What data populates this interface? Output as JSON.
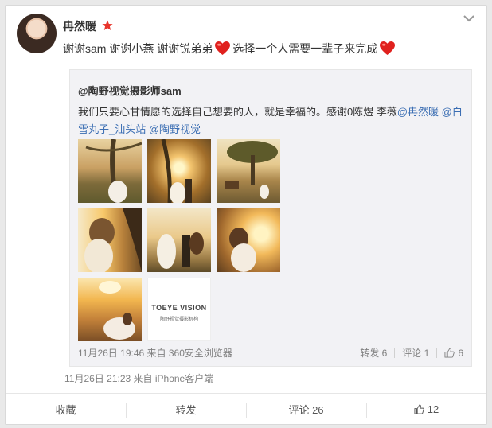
{
  "post": {
    "author": "冉然暖",
    "text_parts": [
      "谢谢sam 谢谢小燕 谢谢锐弟弟",
      "选择一个人需要一辈子来完成"
    ],
    "time": "11月26日 21:23",
    "source": "来自 iPhone客户端"
  },
  "repost": {
    "author": "@陶野视觉摄影师sam",
    "text": "我们只要心甘情愿的选择自己想要的人，就是幸福的。感谢0陈煜 李薇",
    "mentions": [
      "@冉然暖",
      "@白雪丸子_汕头站",
      "@陶野视觉"
    ],
    "time": "11月26日 19:46",
    "source": "来自 360安全浏览器",
    "repost_label": "转发 6",
    "comment_label": "评论 1",
    "like_count": "6",
    "logo_main": "TOEYE VISION",
    "logo_sub": "陶野视觉摄影机构"
  },
  "actions": {
    "favorite": "收藏",
    "repost": "转发",
    "comment": "评论 26",
    "like_count": "12"
  },
  "colors": {
    "link": "#3b6eb3",
    "vip_star": "#e8352b",
    "heart": "#e0211e",
    "meta_text": "#808080"
  },
  "icons": [
    "chevron-down-icon",
    "vip-star-icon",
    "heart-emoji-icon",
    "thumbs-up-icon"
  ]
}
